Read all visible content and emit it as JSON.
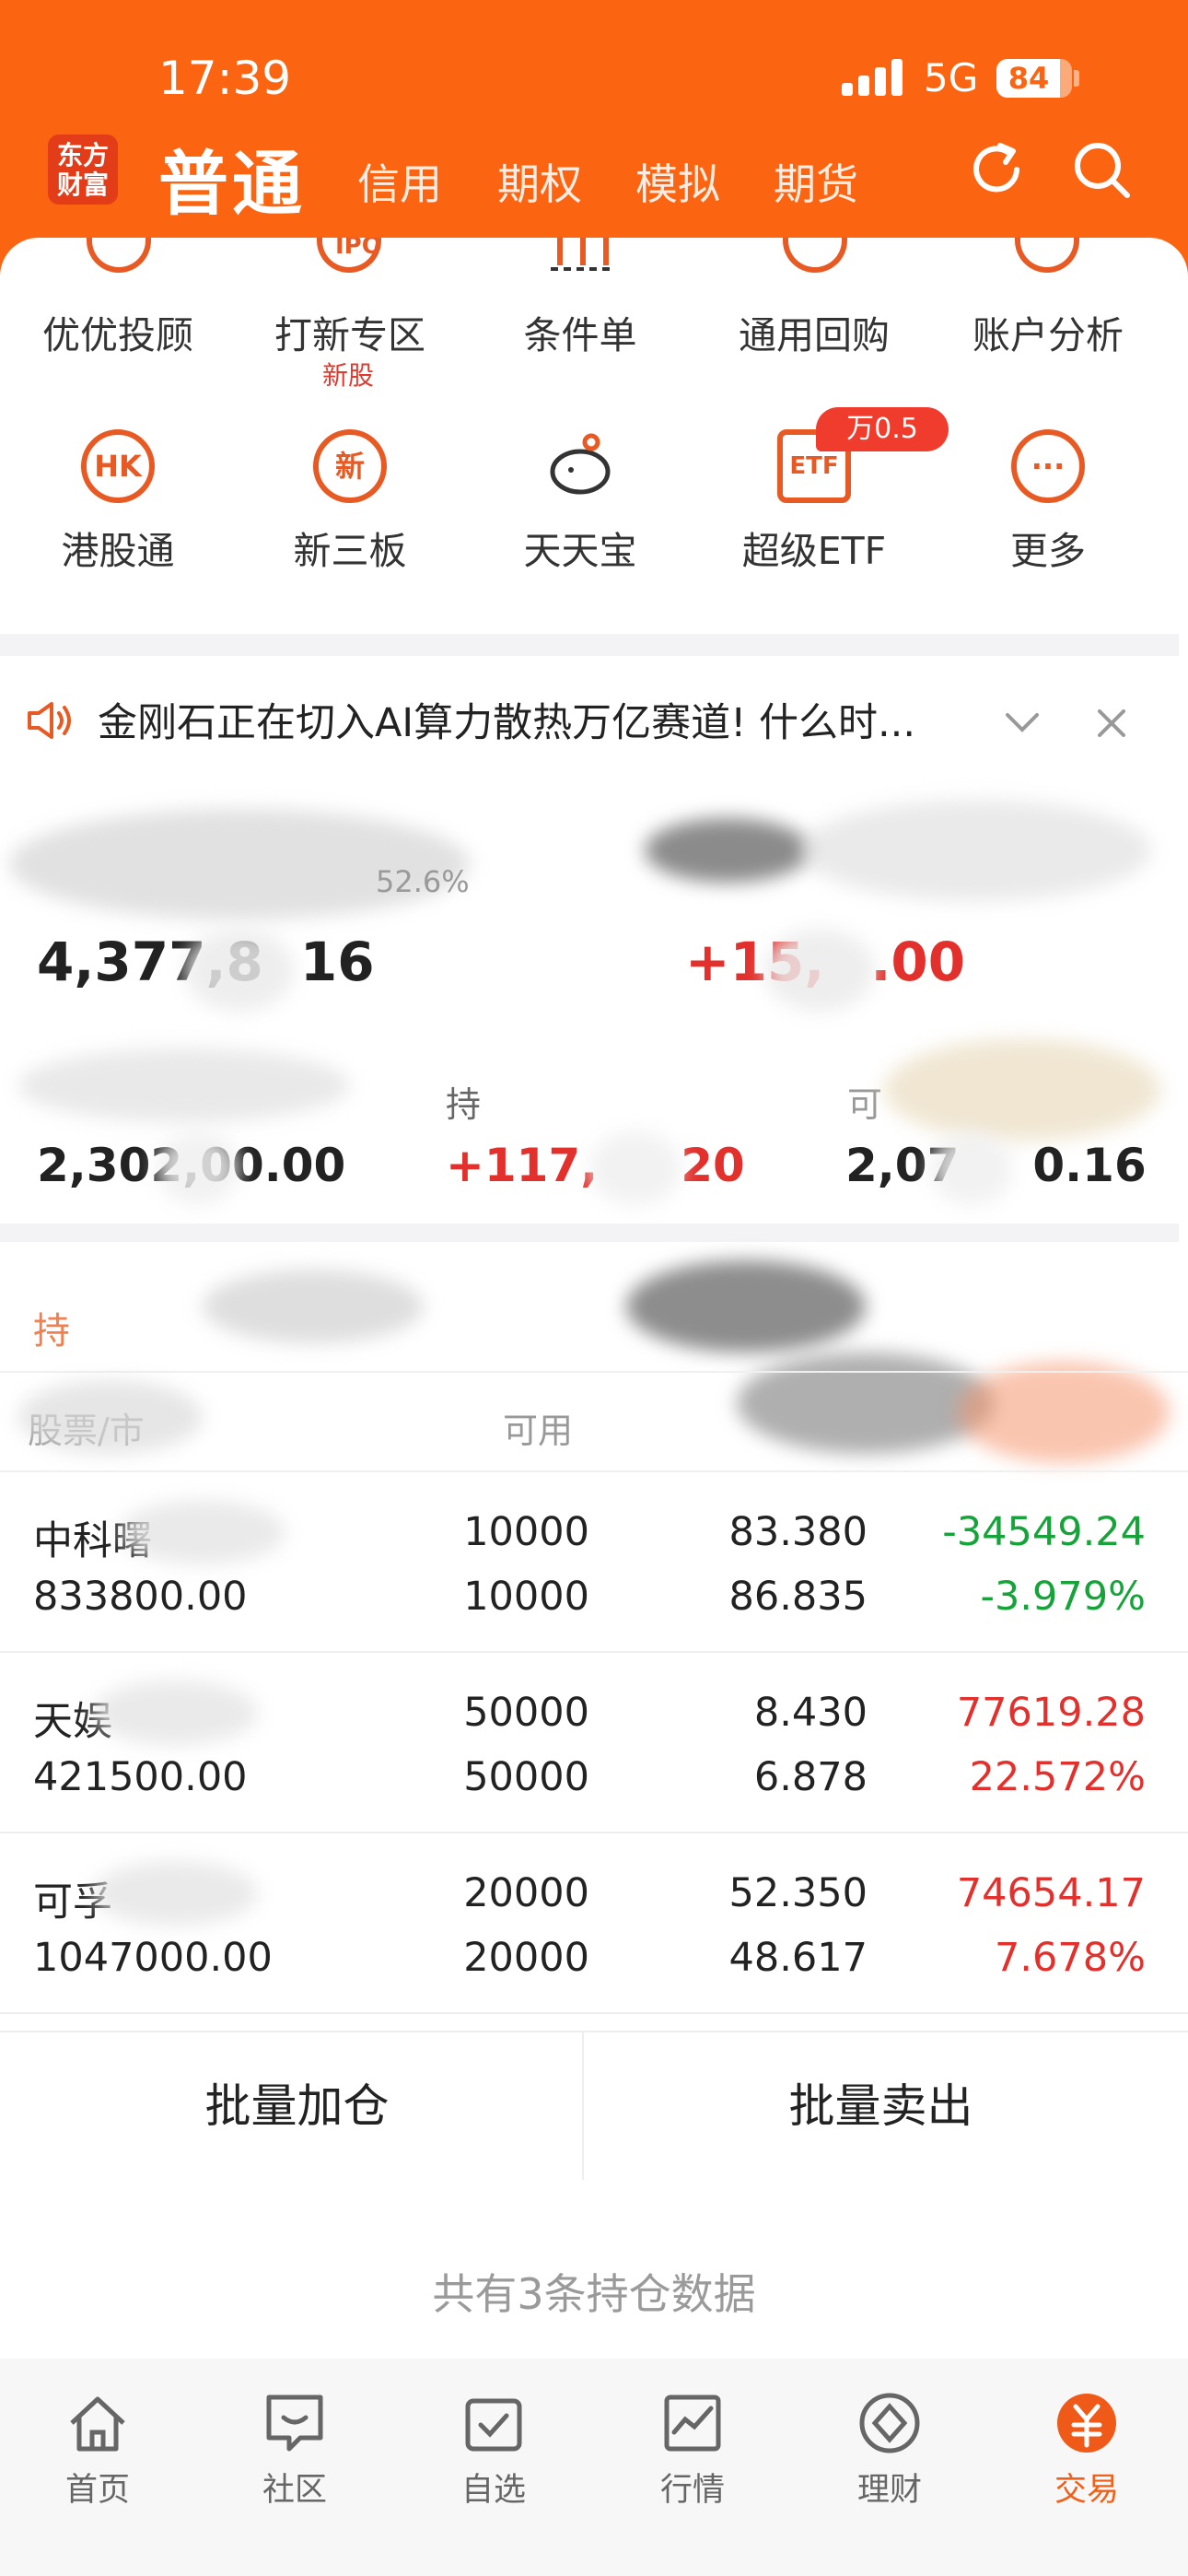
{
  "status_bar": {
    "time": "17:39",
    "network": "5G",
    "battery": "84",
    "battery_level": 0.84
  },
  "header": {
    "logo": "东方\n财富",
    "active_tab": "普通",
    "tabs": [
      "信用",
      "期权",
      "模拟",
      "期货"
    ]
  },
  "quick_menu": {
    "row1": [
      {
        "label": "优优投顾",
        "icon": "advisor-icon"
      },
      {
        "label": "打新专区",
        "icon": "ipo-icon",
        "icon_text": "IPO",
        "badge": "新股"
      },
      {
        "label": "条件单",
        "icon": "condition-order-icon"
      },
      {
        "label": "通用回购",
        "icon": "repo-icon"
      },
      {
        "label": "账户分析",
        "icon": "account-analysis-icon"
      }
    ],
    "row2": [
      {
        "label": "港股通",
        "icon": "hk-connect-icon",
        "icon_text": "HK"
      },
      {
        "label": "新三板",
        "icon": "neeq-icon",
        "icon_text": "新"
      },
      {
        "label": "天天宝",
        "icon": "piggy-bank-icon"
      },
      {
        "label": "超级ETF",
        "icon": "etf-icon",
        "icon_text": "ETF",
        "badge": "万0.5"
      },
      {
        "label": "更多",
        "icon": "more-icon",
        "icon_text": "···"
      }
    ]
  },
  "notice": {
    "text": "金刚石正在切入AI算力散热万亿赛道! 什么时..."
  },
  "account": {
    "ratio": "52.6%",
    "total_asset": "4,377,8",
    "total_asset_tail": "16",
    "daily_pl": "+15,",
    "daily_pl_tail": ".00",
    "market_value": "2,302,",
    "market_value_tail": "00.00",
    "hold_pl_label": "持",
    "hold_pl": "+117,",
    "hold_pl_tail": "20",
    "available_label": "可",
    "available": "2,07",
    "available_tail": "0.16"
  },
  "holdings": {
    "section_label": "持",
    "col_available": "可用",
    "col_left": "股票/市",
    "rows": [
      {
        "name": "中科曙",
        "market_value": "833800.00",
        "qty": "10000",
        "avail": "10000",
        "price": "83.380",
        "cost": "86.835",
        "pl": "-34549.24",
        "pl_pct": "-3.979%",
        "dir": "dn"
      },
      {
        "name": "天娱",
        "market_value": "421500.00",
        "qty": "50000",
        "avail": "50000",
        "price": "8.430",
        "cost": "6.878",
        "pl": "77619.28",
        "pl_pct": "22.572%",
        "dir": "up"
      },
      {
        "name": "可孚",
        "market_value": "1047000.00",
        "qty": "20000",
        "avail": "20000",
        "price": "52.350",
        "cost": "48.617",
        "pl": "74654.17",
        "pl_pct": "7.678%",
        "dir": "up"
      }
    ]
  },
  "actions": {
    "add": "批量加仓",
    "sell": "批量卖出"
  },
  "footer_note": "共有3条持仓数据",
  "bottom_nav": [
    {
      "label": "首页",
      "icon": "home-icon"
    },
    {
      "label": "社区",
      "icon": "community-icon"
    },
    {
      "label": "自选",
      "icon": "watchlist-icon"
    },
    {
      "label": "行情",
      "icon": "market-icon"
    },
    {
      "label": "理财",
      "icon": "wealth-icon"
    },
    {
      "label": "交易",
      "icon": "trade-icon",
      "active": true
    }
  ],
  "colors": {
    "brand": "#fb6410",
    "up": "#e2312d",
    "down": "#16a43a"
  }
}
